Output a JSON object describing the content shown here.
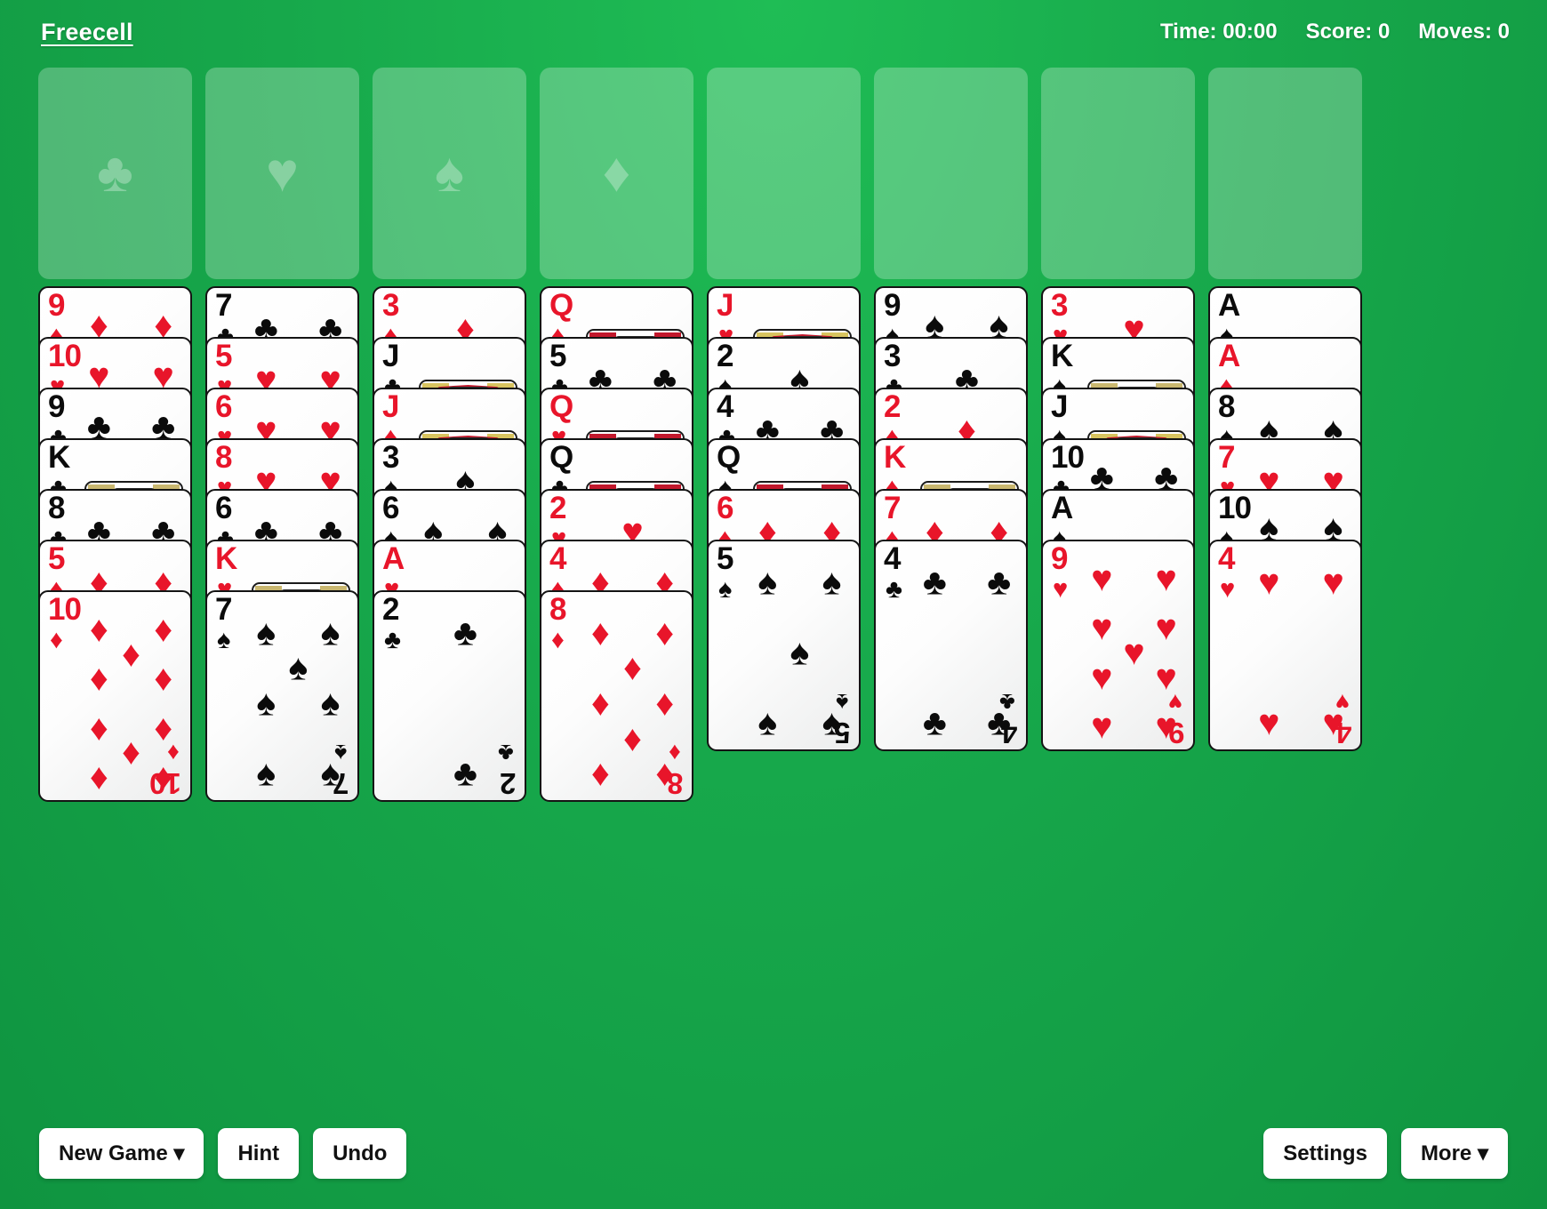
{
  "header": {
    "title": "Freecell",
    "status": [
      {
        "name": "time",
        "label": "Time: 00:00"
      },
      {
        "name": "score",
        "label": "Score: 0"
      },
      {
        "name": "moves",
        "label": "Moves: 0"
      }
    ]
  },
  "slots": [
    {
      "kind": "foundation",
      "suit": "club",
      "pip": "♣"
    },
    {
      "kind": "foundation",
      "suit": "heart",
      "pip": "♥"
    },
    {
      "kind": "foundation",
      "suit": "spade",
      "pip": "♠"
    },
    {
      "kind": "foundation",
      "suit": "diamond",
      "pip": "♦"
    },
    {
      "kind": "freecell",
      "suit": "",
      "pip": ""
    },
    {
      "kind": "freecell",
      "suit": "",
      "pip": ""
    },
    {
      "kind": "freecell",
      "suit": "",
      "pip": ""
    },
    {
      "kind": "freecell",
      "suit": "",
      "pip": ""
    }
  ],
  "tableau": {
    "columns": [
      {
        "cards": [
          {
            "rank": "9",
            "suit": "diamond"
          },
          {
            "rank": "10",
            "suit": "heart"
          },
          {
            "rank": "9",
            "suit": "club"
          },
          {
            "rank": "K",
            "suit": "club"
          },
          {
            "rank": "8",
            "suit": "club"
          },
          {
            "rank": "5",
            "suit": "diamond"
          },
          {
            "rank": "10",
            "suit": "diamond"
          }
        ]
      },
      {
        "cards": [
          {
            "rank": "7",
            "suit": "club"
          },
          {
            "rank": "5",
            "suit": "heart"
          },
          {
            "rank": "6",
            "suit": "heart"
          },
          {
            "rank": "8",
            "suit": "heart"
          },
          {
            "rank": "6",
            "suit": "club"
          },
          {
            "rank": "K",
            "suit": "heart"
          },
          {
            "rank": "7",
            "suit": "spade"
          }
        ]
      },
      {
        "cards": [
          {
            "rank": "3",
            "suit": "diamond"
          },
          {
            "rank": "J",
            "suit": "club"
          },
          {
            "rank": "J",
            "suit": "diamond"
          },
          {
            "rank": "3",
            "suit": "spade"
          },
          {
            "rank": "6",
            "suit": "spade"
          },
          {
            "rank": "A",
            "suit": "heart"
          },
          {
            "rank": "2",
            "suit": "club"
          }
        ]
      },
      {
        "cards": [
          {
            "rank": "Q",
            "suit": "diamond"
          },
          {
            "rank": "5",
            "suit": "club"
          },
          {
            "rank": "Q",
            "suit": "heart"
          },
          {
            "rank": "Q",
            "suit": "club"
          },
          {
            "rank": "2",
            "suit": "heart"
          },
          {
            "rank": "4",
            "suit": "diamond"
          },
          {
            "rank": "8",
            "suit": "diamond"
          }
        ]
      },
      {
        "cards": [
          {
            "rank": "J",
            "suit": "heart"
          },
          {
            "rank": "2",
            "suit": "spade"
          },
          {
            "rank": "4",
            "suit": "club"
          },
          {
            "rank": "Q",
            "suit": "spade"
          },
          {
            "rank": "6",
            "suit": "diamond"
          },
          {
            "rank": "5",
            "suit": "spade"
          }
        ]
      },
      {
        "cards": [
          {
            "rank": "9",
            "suit": "spade"
          },
          {
            "rank": "3",
            "suit": "club"
          },
          {
            "rank": "2",
            "suit": "diamond"
          },
          {
            "rank": "K",
            "suit": "diamond"
          },
          {
            "rank": "7",
            "suit": "diamond"
          },
          {
            "rank": "4",
            "suit": "club"
          }
        ]
      },
      {
        "cards": [
          {
            "rank": "3",
            "suit": "heart"
          },
          {
            "rank": "K",
            "suit": "spade"
          },
          {
            "rank": "J",
            "suit": "spade"
          },
          {
            "rank": "10",
            "suit": "club"
          },
          {
            "rank": "A",
            "suit": "spade"
          },
          {
            "rank": "9",
            "suit": "heart"
          }
        ]
      },
      {
        "cards": [
          {
            "rank": "A",
            "suit": "spade"
          },
          {
            "rank": "A",
            "suit": "diamond"
          },
          {
            "rank": "8",
            "suit": "spade"
          },
          {
            "rank": "7",
            "suit": "heart"
          },
          {
            "rank": "10",
            "suit": "spade"
          },
          {
            "rank": "4",
            "suit": "heart"
          }
        ]
      }
    ]
  },
  "toolbar": {
    "left": [
      {
        "name": "new-game",
        "label": "New Game ▾"
      },
      {
        "name": "hint",
        "label": "Hint"
      },
      {
        "name": "undo",
        "label": "Undo"
      }
    ],
    "right": [
      {
        "name": "settings",
        "label": "Settings"
      },
      {
        "name": "more",
        "label": "More ▾"
      }
    ]
  },
  "colors": {
    "felt": "#17a84b",
    "red_suit": "#e8152a",
    "black_suit": "#0b0b0b",
    "slot": "rgba(255,255,255,0.26)",
    "card_face": "#ffffff"
  }
}
